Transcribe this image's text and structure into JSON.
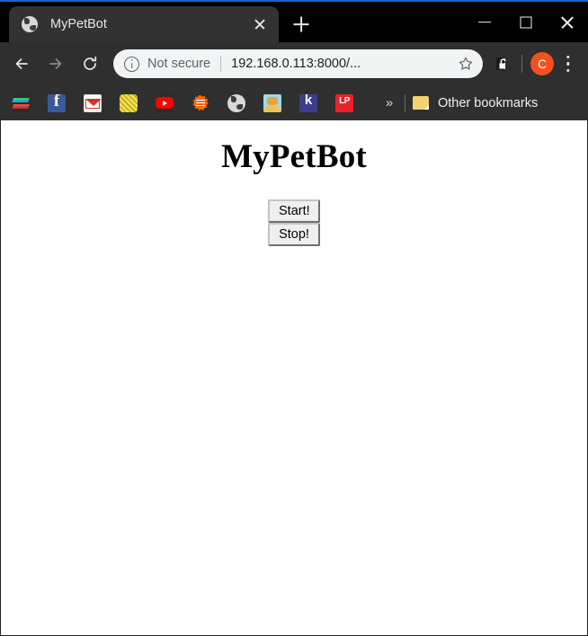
{
  "window": {
    "controls": {
      "minimize": "minimize-button",
      "maximize": "maximize-button",
      "close": "close-button"
    }
  },
  "tabstrip": {
    "tabs": [
      {
        "title": "MyPetBot",
        "favicon": "globe-icon",
        "close_label": "close-tab"
      }
    ],
    "new_tab_label": "new-tab"
  },
  "toolbar": {
    "back_label": "back-icon",
    "forward_label": "forward-icon",
    "reload_label": "reload-icon",
    "omnibox": {
      "security_icon": "info-circle-icon",
      "security_text": "Not secure",
      "url": "192.168.0.113:8000/...",
      "bookmark_star": "star-icon"
    },
    "extension_icon": "unlocked-padlock-icon",
    "profile_initial": "C",
    "menu_label": "three-dot-menu"
  },
  "bookmarks_bar": {
    "items": [
      {
        "name": "books-bookmark",
        "icon": "books-icon"
      },
      {
        "name": "facebook-bookmark",
        "icon": "facebook-icon"
      },
      {
        "name": "gmail-bookmark",
        "icon": "gmail-icon"
      },
      {
        "name": "yellow-bookmark",
        "icon": "yellow-square-icon"
      },
      {
        "name": "youtube-bookmark",
        "icon": "youtube-icon"
      },
      {
        "name": "orange-burst-bookmark",
        "icon": "orange-burst-icon"
      },
      {
        "name": "globe-bookmark",
        "icon": "globe-icon"
      },
      {
        "name": "avatar-bookmark",
        "icon": "avatar-icon"
      },
      {
        "name": "k-bookmark",
        "icon": "letter-k-icon"
      },
      {
        "name": "lp-bookmark",
        "icon": "lp-icon"
      }
    ],
    "overflow_label": "»",
    "other_bookmarks_label": "Other bookmarks",
    "other_bookmarks_icon": "folder-icon"
  },
  "page": {
    "heading": "MyPetBot",
    "buttons": [
      {
        "label": "Start!",
        "name": "start-button"
      },
      {
        "label": "Stop!",
        "name": "stop-button"
      }
    ]
  },
  "colors": {
    "chrome_dark": "#2f2f2f",
    "tab_active": "#323232",
    "accent_blue": "#1565c0",
    "avatar_orange": "#f4511e",
    "omnibox_bg": "#f1f3f4"
  }
}
